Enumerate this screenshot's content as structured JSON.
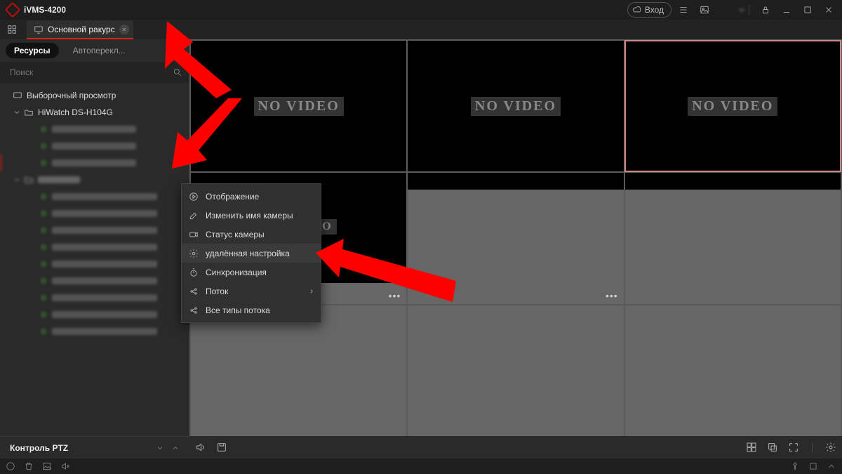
{
  "app": {
    "title": "iVMS-4200"
  },
  "titlebar": {
    "login_label": "Вход"
  },
  "tabs": {
    "main": "Основной ракурс"
  },
  "sidebar": {
    "tabs": {
      "resources": "Ресурсы",
      "autoswitch": "Автоперекл..."
    },
    "search_placeholder": "Поиск",
    "root": "Выборочный просмотр",
    "device": "HiWatch DS-H104G"
  },
  "ptz": {
    "label": "Контроль PTZ"
  },
  "grid": {
    "novideo": "NO VIDEO"
  },
  "context_menu": {
    "display": "Отображение",
    "rename": "Изменить имя камеры",
    "status": "Статус камеры",
    "remote": "удалённая настройка",
    "sync": "Синхронизация",
    "stream": "Поток",
    "all_streams": "Все типы потока"
  }
}
